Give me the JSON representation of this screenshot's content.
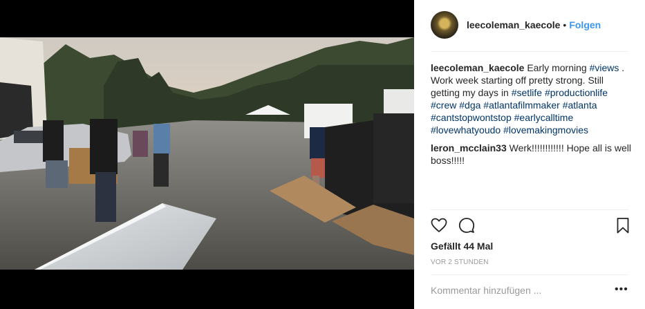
{
  "post": {
    "username": "leecoleman_kaecole",
    "separator": "•",
    "follow_label": "Folgen",
    "caption": {
      "username": "leecoleman_kaecole",
      "segments": [
        {
          "text": "Early morning ",
          "tag": false
        },
        {
          "text": "#views",
          "tag": true
        },
        {
          "text": " . Work week starting off pretty strong. Still getting my days in ",
          "tag": false
        },
        {
          "text": "#setlife",
          "tag": true
        },
        {
          "text": " ",
          "tag": false
        },
        {
          "text": "#productionlife",
          "tag": true
        },
        {
          "text": " ",
          "tag": false
        },
        {
          "text": "#crew",
          "tag": true
        },
        {
          "text": " ",
          "tag": false
        },
        {
          "text": "#dga",
          "tag": true
        },
        {
          "text": " ",
          "tag": false
        },
        {
          "text": "#atlantafilmmaker",
          "tag": true
        },
        {
          "text": " ",
          "tag": false
        },
        {
          "text": "#atlanta",
          "tag": true
        },
        {
          "text": " ",
          "tag": false
        },
        {
          "text": "#cantstopwontstop",
          "tag": true
        },
        {
          "text": " ",
          "tag": false
        },
        {
          "text": "#earlycalltime",
          "tag": true
        },
        {
          "text": " ",
          "tag": false
        },
        {
          "text": "#lovewhatyoudo",
          "tag": true
        },
        {
          "text": " ",
          "tag": false
        },
        {
          "text": "#lovemakingmovies",
          "tag": true
        }
      ]
    },
    "comments": [
      {
        "username": "leron_mcclain33",
        "text": "Werk!!!!!!!!!!!! Hope all is well boss!!!!!"
      }
    ],
    "likes_label": "Gefällt 44 Mal",
    "time_label": "VOR 2 STUNDEN",
    "add_comment_placeholder": "Kommentar hinzufügen ...",
    "more_label": "•••"
  },
  "icons": {
    "like": "heart-icon",
    "comment": "comment-icon",
    "save": "bookmark-icon",
    "more": "more-options-icon"
  },
  "colors": {
    "link": "#3897f0",
    "hashtag": "#003569",
    "text": "#262626",
    "muted": "#999999",
    "divider": "#efefef"
  }
}
